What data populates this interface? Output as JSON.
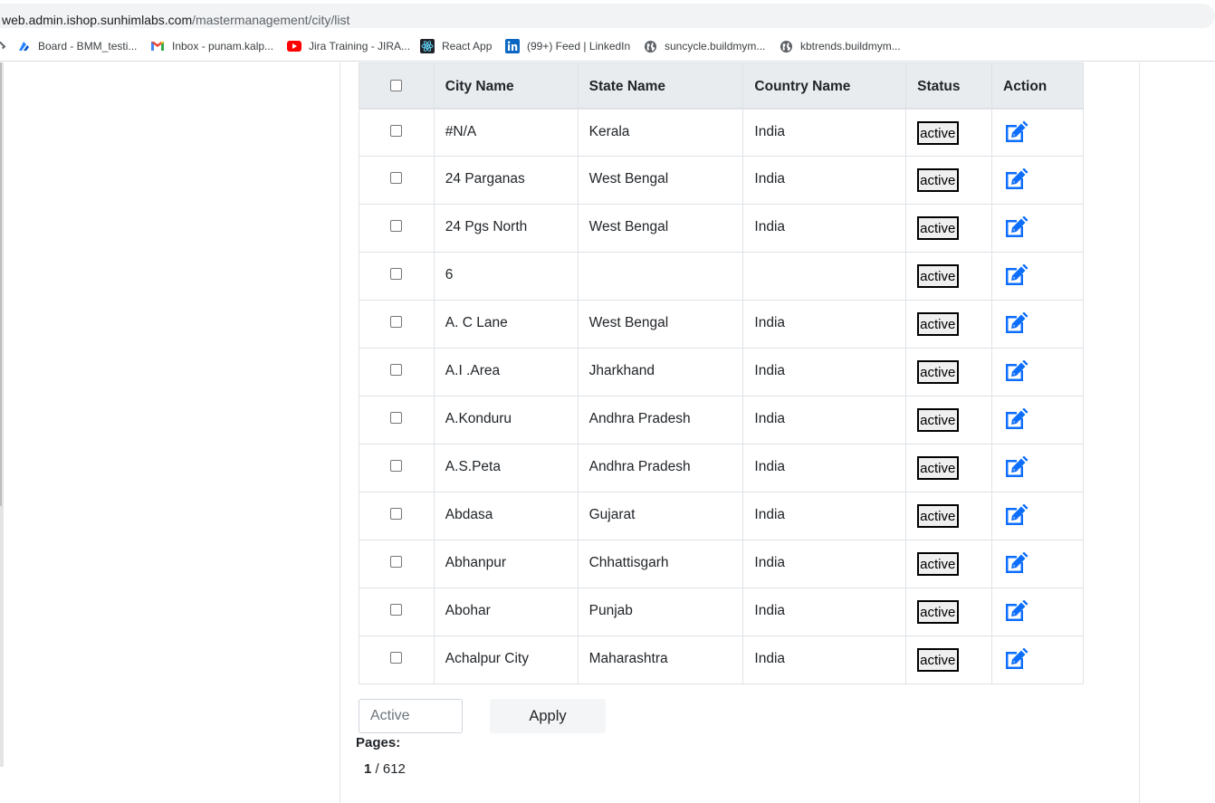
{
  "browser": {
    "url_host": "web.admin.ishop.sunhimlabs.com",
    "url_path": "/mastermanagement/city/list",
    "bookmarks": [
      {
        "label": "Board - BMM_testi...",
        "icon": "jira-board-icon"
      },
      {
        "label": "Inbox - punam.kalp...",
        "icon": "gmail-icon"
      },
      {
        "label": "Jira Training - JIRA...",
        "icon": "youtube-icon"
      },
      {
        "label": "React App",
        "icon": "react-icon"
      },
      {
        "label": "(99+) Feed | LinkedIn",
        "icon": "linkedin-icon"
      },
      {
        "label": "suncycle.buildmym...",
        "icon": "globe-icon"
      },
      {
        "label": "kbtrends.buildmym...",
        "icon": "globe-icon"
      }
    ]
  },
  "table": {
    "headers": {
      "city": "City Name",
      "state": "State Name",
      "country": "Country Name",
      "status": "Status",
      "action": "Action"
    },
    "rows": [
      {
        "city": "#N/A",
        "state": "Kerala",
        "country": "India",
        "status": "active"
      },
      {
        "city": "24 Parganas",
        "state": "West Bengal",
        "country": "India",
        "status": "active"
      },
      {
        "city": "24 Pgs North",
        "state": "West Bengal",
        "country": "India",
        "status": "active"
      },
      {
        "city": "6",
        "state": "",
        "country": "",
        "status": "active"
      },
      {
        "city": "A. C Lane",
        "state": "West Bengal",
        "country": "India",
        "status": "active"
      },
      {
        "city": "A.I .Area",
        "state": "Jharkhand",
        "country": "India",
        "status": "active"
      },
      {
        "city": "A.Konduru",
        "state": "Andhra Pradesh",
        "country": "India",
        "status": "active"
      },
      {
        "city": "A.S.Peta",
        "state": "Andhra Pradesh",
        "country": "India",
        "status": "active"
      },
      {
        "city": "Abdasa",
        "state": "Gujarat",
        "country": "India",
        "status": "active"
      },
      {
        "city": "Abhanpur",
        "state": "Chhattisgarh",
        "country": "India",
        "status": "active"
      },
      {
        "city": "Abohar",
        "state": "Punjab",
        "country": "India",
        "status": "active"
      },
      {
        "city": "Achalpur City",
        "state": "Maharashtra",
        "country": "India",
        "status": "active"
      }
    ]
  },
  "bulk": {
    "placeholder": "Active",
    "apply_label": "Apply"
  },
  "pagination": {
    "label": "Pages:",
    "current": "1",
    "separator": " / ",
    "total": "612"
  },
  "colors": {
    "edit_icon": "#0d6efd",
    "header_bg": "#e9ecef",
    "border": "#dee2e6"
  }
}
